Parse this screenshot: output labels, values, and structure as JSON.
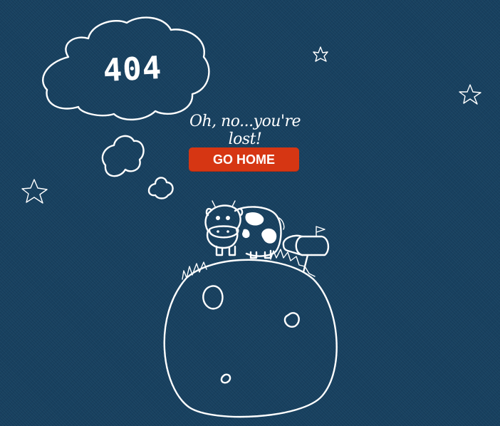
{
  "error": {
    "code": "404",
    "message": "Oh, no...you're lost!"
  },
  "actions": {
    "go_home_label": "GO HOME"
  },
  "colors": {
    "background": "#17405f",
    "button": "#d63613",
    "ink": "#ffffff"
  },
  "icons": [
    "cloud-icon",
    "star-icon",
    "cow-icon",
    "mailbox-icon",
    "planet-icon"
  ]
}
